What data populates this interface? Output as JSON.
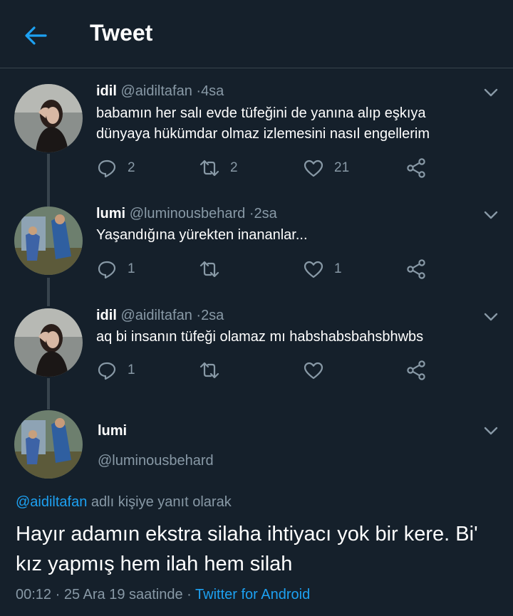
{
  "header": {
    "title": "Tweet"
  },
  "thread": [
    {
      "name": "idil",
      "handle": "@aidiltafan",
      "time": "4sa",
      "text": "babamın her salı evde tüfeğini de yanına alıp eşkıya dünyaya hükümdar olmaz izlemesini nasıl engellerim",
      "replies": "2",
      "retweets": "2",
      "likes": "21"
    },
    {
      "name": "lumi",
      "handle": "@luminousbehard",
      "time": "2sa",
      "text": "Yaşandığına yürekten inananlar...",
      "replies": "1",
      "retweets": "",
      "likes": "1"
    },
    {
      "name": "idil",
      "handle": "@aidiltafan",
      "time": "2sa",
      "text": "aq bi insanın tüfeği olamaz mı habshabsbahsbhwbs",
      "replies": "1",
      "retweets": "",
      "likes": ""
    }
  ],
  "main": {
    "name": "lumi",
    "handle": "@luminousbehard",
    "reply_to_handle": "@aidiltafan",
    "reply_to_suffix": " adlı kişiye yanıt olarak",
    "text": "Hayır adamın ekstra silaha ihtiyacı yok bir kere. Bi' kız yapmış hem ilah hem silah",
    "timestamp": "00:12 · 25 Ara 19 saatinde · ",
    "source": "Twitter for Android"
  },
  "colors": {
    "background": "#15202b",
    "accent": "#1da1f2",
    "secondary_text": "#8899a6",
    "border": "#38444d"
  }
}
